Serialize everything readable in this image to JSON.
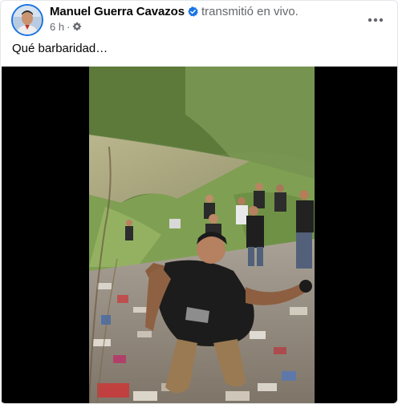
{
  "post": {
    "author_name": "Manuel Guerra Cavazos",
    "action_text": "transmitió en vivo.",
    "timestamp": "6 h",
    "separator": "·",
    "audience_icon": "gear-icon",
    "verified_icon": "verified-badge-icon",
    "more_icon": "more-horizontal-icon",
    "text": "Qué barbaridad…"
  },
  "colors": {
    "verified": "#1b74e4",
    "secondary_text": "#65676b",
    "video_bg": "#000000"
  }
}
